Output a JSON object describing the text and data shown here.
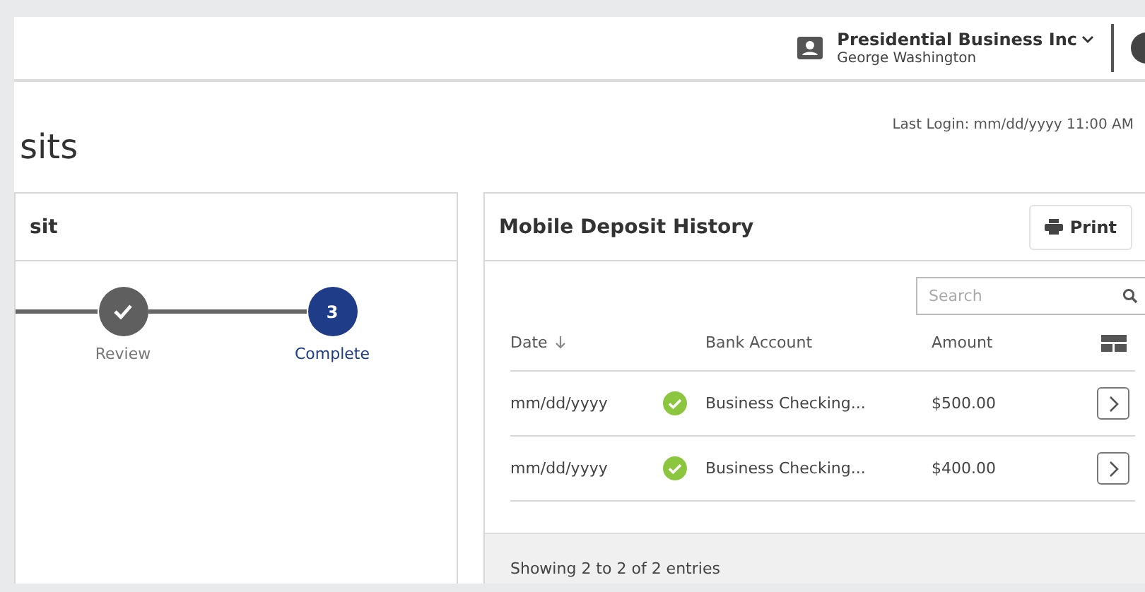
{
  "header": {
    "company": "Presidential Business Inc",
    "user": "George Washington"
  },
  "page": {
    "title": "sits",
    "last_login": "Last Login: mm/dd/yyyy  11:00 AM"
  },
  "deposit_panel": {
    "title": "sit",
    "steps": [
      {
        "label": "Review",
        "completed": true,
        "current": false
      },
      {
        "label": "Complete",
        "number": "3",
        "completed": false,
        "current": true
      }
    ]
  },
  "history_panel": {
    "title": "Mobile Deposit History",
    "print_button": "Print",
    "search": {
      "placeholder": "Search"
    },
    "columns": [
      {
        "label": "Date",
        "sorted": true
      },
      {
        "label": "Bank Account",
        "sorted": false
      },
      {
        "label": "Amount",
        "sorted": false
      }
    ],
    "rows": [
      {
        "date": "mm/dd/yyyy",
        "verified": true,
        "account": "Business Checking...",
        "amount": "$500.00"
      },
      {
        "date": "mm/dd/yyyy",
        "verified": true,
        "account": "Business Checking...",
        "amount": "$400.00"
      }
    ],
    "footer": "Showing 2 to 2 of 2 entries"
  }
}
